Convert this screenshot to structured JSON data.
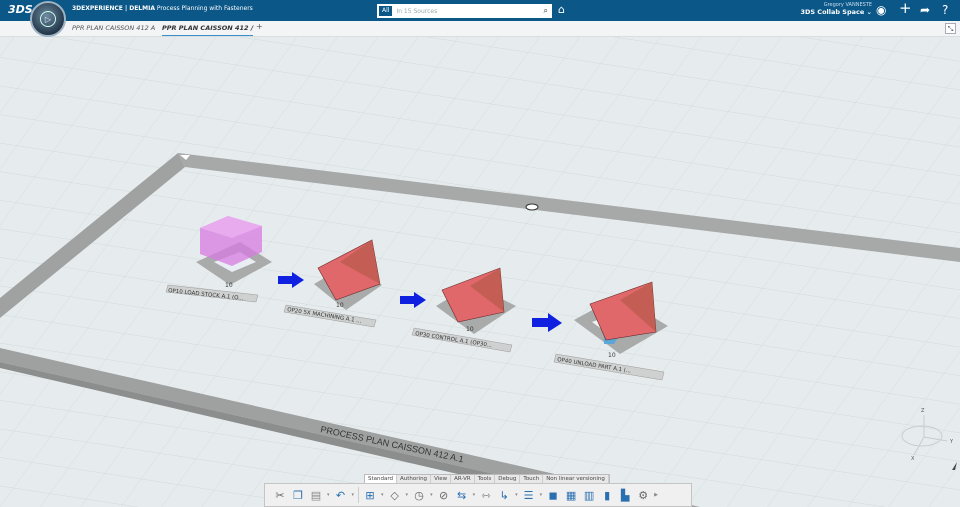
{
  "topbar": {
    "logo": "3DS",
    "brand": "3DEXPERIENCE | DELMIA",
    "app": "Process Planning with Fasteners",
    "search_scope": "All",
    "search_placeholder": "In 15 Sources",
    "user_name": "Gregory VANNESTE",
    "collab_space": "3DS Collab Space"
  },
  "tabs": [
    {
      "label": "PPR PLAN CAISSON 412 A",
      "active": false
    },
    {
      "label": "PPR PLAN CAISSON 412 /",
      "active": true
    }
  ],
  "add_tab": "+",
  "scene": {
    "plan_label": "PROCESS PLAN CAISSON 412 A.1",
    "operations": [
      {
        "label": "OP10 LOAD STOCK A.1 (O...",
        "count": "10"
      },
      {
        "label": "OP20 5X MACHINING A.1 ...",
        "count": "10"
      },
      {
        "label": "OP30 CONTROL A.1 (OP30...",
        "count": "10"
      },
      {
        "label": "OP40 UNLOAD PART A.1 (...",
        "count": "10"
      }
    ],
    "axes": {
      "x": "X",
      "y": "Y",
      "z": "Z"
    },
    "colors": {
      "stock": "#d77be0",
      "part": "#e0686a",
      "arrow": "#1020e0",
      "platform": "#a9abab"
    }
  },
  "toolbar": {
    "tabs": [
      "Standard",
      "Authoring",
      "View",
      "AR-VR",
      "Tools",
      "Debug",
      "Touch",
      "Non linear versioning"
    ],
    "active_tab": "Standard"
  }
}
